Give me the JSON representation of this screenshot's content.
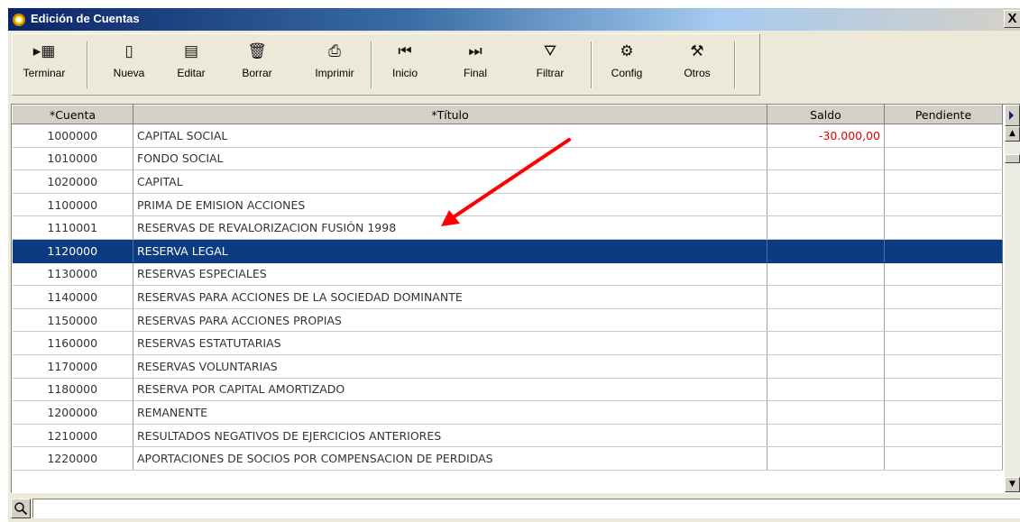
{
  "window": {
    "title": "Edición de Cuentas",
    "close_label": "X"
  },
  "toolbar": {
    "buttons": [
      {
        "label": "Terminar",
        "icon": "exit-icon",
        "glyph": "▸▦"
      },
      {
        "label": "Nueva",
        "icon": "new-document-icon",
        "glyph": "▯"
      },
      {
        "label": "Editar",
        "icon": "edit-icon",
        "glyph": "▤"
      },
      {
        "label": "Borrar",
        "icon": "trash-icon",
        "glyph": "🗑"
      },
      {
        "label": "Imprimir",
        "icon": "printer-icon",
        "glyph": "⎙"
      },
      {
        "label": "Inicio",
        "icon": "first-record-icon",
        "glyph": "⏮"
      },
      {
        "label": "Final",
        "icon": "last-record-icon",
        "glyph": "⏭"
      },
      {
        "label": "Filtrar",
        "icon": "filter-icon",
        "glyph": "⛛"
      },
      {
        "label": "Config",
        "icon": "gear-icon",
        "glyph": "⚙"
      },
      {
        "label": "Otros",
        "icon": "tools-icon",
        "glyph": "⚒"
      }
    ]
  },
  "grid": {
    "columns": [
      "*Cuenta",
      "*Título",
      "Saldo",
      "Pendiente"
    ],
    "rows": [
      {
        "cuenta": "1000000",
        "titulo": "CAPITAL SOCIAL",
        "saldo": "-30.000,00",
        "pendiente": ""
      },
      {
        "cuenta": "1010000",
        "titulo": "FONDO SOCIAL",
        "saldo": "",
        "pendiente": ""
      },
      {
        "cuenta": "1020000",
        "titulo": "CAPITAL",
        "saldo": "",
        "pendiente": ""
      },
      {
        "cuenta": "1100000",
        "titulo": "PRIMA DE EMISION ACCIONES",
        "saldo": "",
        "pendiente": ""
      },
      {
        "cuenta": "1110001",
        "titulo": "RESERVAS DE REVALORIZACION FUSIÓN 1998",
        "saldo": "",
        "pendiente": ""
      },
      {
        "cuenta": "1120000",
        "titulo": "RESERVA LEGAL",
        "saldo": "",
        "pendiente": "",
        "selected": true
      },
      {
        "cuenta": "1130000",
        "titulo": "RESERVAS ESPECIALES",
        "saldo": "",
        "pendiente": ""
      },
      {
        "cuenta": "1140000",
        "titulo": "RESERVAS PARA ACCIONES DE LA SOCIEDAD DOMINANTE",
        "saldo": "",
        "pendiente": ""
      },
      {
        "cuenta": "1150000",
        "titulo": "RESERVAS PARA ACCIONES PROPIAS",
        "saldo": "",
        "pendiente": ""
      },
      {
        "cuenta": "1160000",
        "titulo": "RESERVAS ESTATUTARIAS",
        "saldo": "",
        "pendiente": ""
      },
      {
        "cuenta": "1170000",
        "titulo": "RESERVAS VOLUNTARIAS",
        "saldo": "",
        "pendiente": ""
      },
      {
        "cuenta": "1180000",
        "titulo": "RESERVA POR CAPITAL AMORTIZADO",
        "saldo": "",
        "pendiente": ""
      },
      {
        "cuenta": "1200000",
        "titulo": "REMANENTE",
        "saldo": "",
        "pendiente": ""
      },
      {
        "cuenta": "1210000",
        "titulo": "RESULTADOS NEGATIVOS DE EJERCICIOS ANTERIORES",
        "saldo": "",
        "pendiente": ""
      },
      {
        "cuenta": "1220000",
        "titulo": "APORTACIONES DE SOCIOS POR COMPENSACION DE PERDIDAS",
        "saldo": "",
        "pendiente": ""
      }
    ]
  },
  "search": {
    "value": "",
    "icon": "magnifier-icon"
  },
  "colors": {
    "selection": "#0b3c82",
    "negative_value": "#e00000",
    "annotation_arrow": "#ff0000"
  }
}
